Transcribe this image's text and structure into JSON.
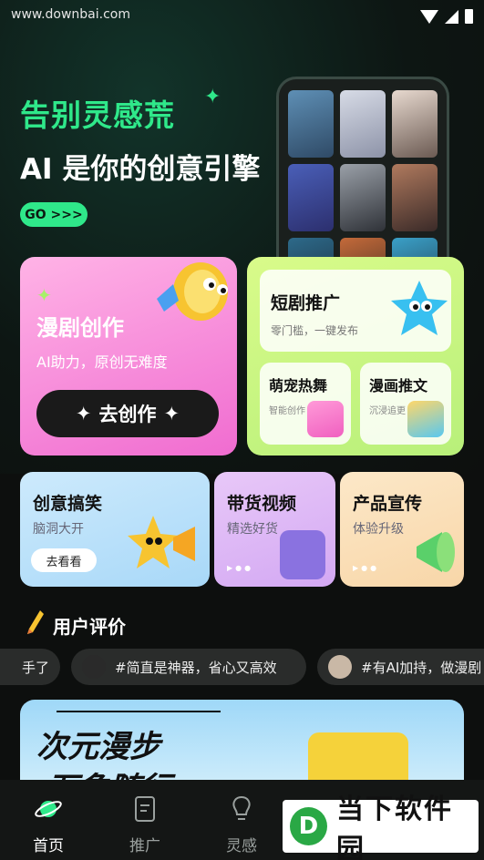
{
  "status_bar": {
    "watermark": "www.downbai.com"
  },
  "hero": {
    "title": "告别灵感荒",
    "subtitle": "AI 是你的创意引擎",
    "go_button": "GO >>>"
  },
  "feature_main": {
    "title": "漫剧创作",
    "subtitle": "AI助力，原创无难度",
    "button": "去创作"
  },
  "feature_side": {
    "top": {
      "title": "短剧推广",
      "subtitle": "零门槛，一键发布"
    },
    "bottom_left": {
      "title": "萌宠热舞",
      "subtitle": "智能创作"
    },
    "bottom_right": {
      "title": "漫画推文",
      "subtitle": "沉浸追更"
    }
  },
  "tiles": [
    {
      "title": "创意搞笑",
      "subtitle": "脑洞大开",
      "button": "去看看"
    },
    {
      "title": "带货视频",
      "subtitle": "精选好货"
    },
    {
      "title": "产品宣传",
      "subtitle": "体验升级"
    }
  ],
  "reviews": {
    "title": "用户评价",
    "items": [
      "手了",
      "#简直是神器，省心又高效",
      "#有AI加持，做漫剧"
    ]
  },
  "banner": {
    "line1": "次元漫步",
    "line2": "万象随行"
  },
  "tabbar": {
    "items": [
      {
        "label": "首页",
        "icon": "planet-icon",
        "active": true
      },
      {
        "label": "推广",
        "icon": "document-icon"
      },
      {
        "label": "灵感",
        "icon": "lightbulb-icon"
      }
    ]
  },
  "logo": {
    "text": "当下软件园",
    "mark": "D"
  },
  "colors": {
    "accent": "#2fe88a",
    "pink_card": "#f06cd0",
    "green_card": "#c5f57f"
  }
}
